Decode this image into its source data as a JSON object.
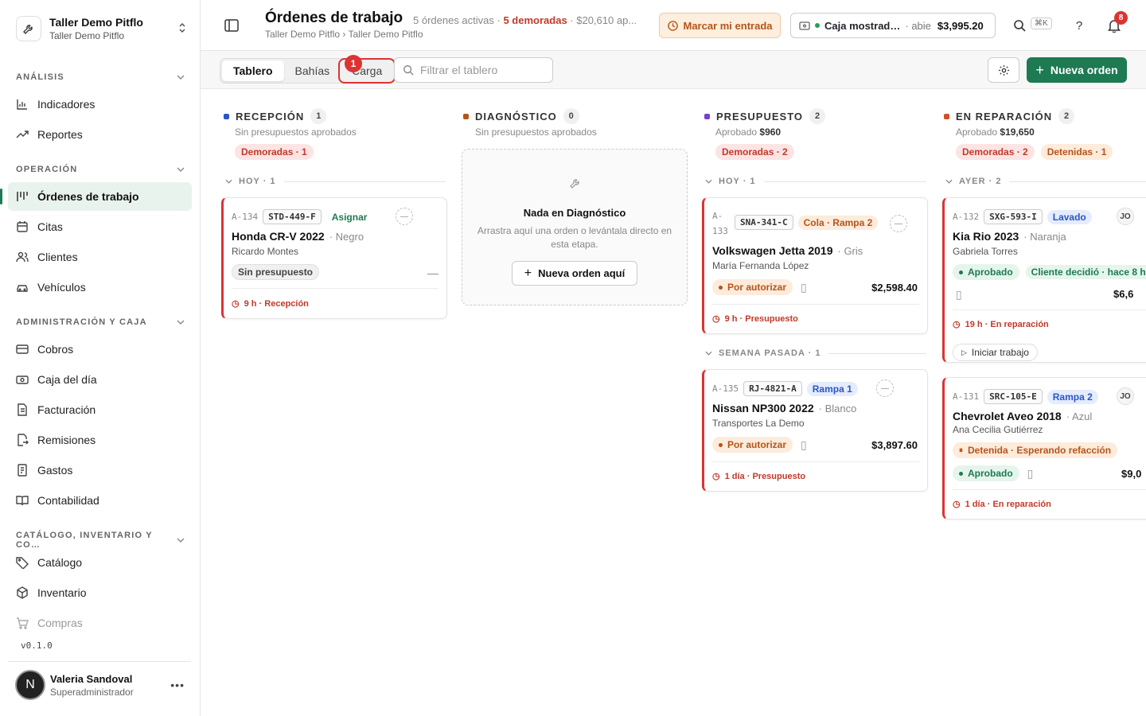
{
  "sidebar": {
    "workspace": {
      "name": "Taller Demo Pitflo",
      "sub": "Taller Demo Pitflo"
    },
    "sections": [
      {
        "label": "ANÁLISIS"
      },
      {
        "label": "OPERACIÓN"
      },
      {
        "label": "ADMINISTRACIÓN Y CAJA"
      },
      {
        "label": "CATÁLOGO, INVENTARIO Y CO…"
      }
    ],
    "items": [
      {
        "label": "Indicadores"
      },
      {
        "label": "Reportes"
      },
      {
        "label": "Órdenes de trabajo"
      },
      {
        "label": "Citas"
      },
      {
        "label": "Clientes"
      },
      {
        "label": "Vehículos"
      },
      {
        "label": "Cobros"
      },
      {
        "label": "Caja del día"
      },
      {
        "label": "Facturación"
      },
      {
        "label": "Remisiones"
      },
      {
        "label": "Gastos"
      },
      {
        "label": "Contabilidad"
      },
      {
        "label": "Catálogo"
      },
      {
        "label": "Inventario"
      },
      {
        "label": "Compras"
      }
    ],
    "version": "v0.1.0",
    "user": {
      "initial": "N",
      "name": "Valeria Sandoval",
      "role": "Superadministrador"
    }
  },
  "topbar": {
    "title": "Órdenes de trabajo",
    "meta_active": "5 órdenes activas ·",
    "meta_delayed": "5 demoradas",
    "meta_rest": "· $20,610 ap...",
    "breadcrumb": "Taller Demo Pitflo › Taller Demo Pitflo",
    "checkin_label": "Marcar mi entrada",
    "register": {
      "name": "Caja mostrad…",
      "status": "abie",
      "amount": "$3,995.20"
    },
    "shortcut": "⌘K",
    "help": "?",
    "notifications": "8"
  },
  "toolbar": {
    "tabs": [
      "Tablero",
      "Bahías",
      "Carga"
    ],
    "marker": "1",
    "filter_placeholder": "Filtrar el tablero",
    "new_order": "Nueva orden"
  },
  "columns": [
    {
      "title": "RECEPCIÓN",
      "count": "1",
      "color": "#2a56c6",
      "sub": "Sin presupuestos aprobados",
      "pills": [
        "Demoradas · 1"
      ],
      "groups": [
        "HOY · 1"
      ],
      "cards": [
        {
          "id": "A-134",
          "plate": "STD-449-F",
          "tag": "Asignar",
          "vehicle": "Honda CR-V 2022",
          "color": "Negro",
          "customer": "Ricardo Montes",
          "status": "Sin presupuesto",
          "dash": "—",
          "footer": "9 h · Recepción"
        }
      ]
    },
    {
      "title": "DIAGNÓSTICO",
      "count": "0",
      "color": "#b5541a",
      "sub": "Sin presupuestos aprobados",
      "empty": {
        "title": "Nada en Diagnóstico",
        "desc": "Arrastra aquí una orden o levántala directo en esta etapa.",
        "button": "Nueva orden aquí"
      }
    },
    {
      "title": "PRESUPUESTO",
      "count": "2",
      "color": "#7b3fd1",
      "sub_label": "Aprobado",
      "sub_value": "$960",
      "pills": [
        "Demoradas · 2"
      ],
      "groups": [
        "HOY · 1",
        "SEMANA PASADA · 1"
      ],
      "cards": [
        {
          "id_a": "A-",
          "id_b": "133",
          "plate": "SNA-341-C",
          "tag": "Cola · Rampa 2",
          "vehicle": "Volkswagen Jetta 2019",
          "color": "Gris",
          "customer": "María Fernanda López",
          "status": "Por autorizar",
          "amount": "$2,598.40",
          "footer": "9 h · Presupuesto"
        },
        {
          "id": "A-135",
          "plate": "RJ-4821-A",
          "tag": "Rampa 1",
          "vehicle": "Nissan NP300 2022",
          "color": "Blanco",
          "customer": "Transportes La Demo",
          "status": "Por autorizar",
          "amount": "$3,897.60",
          "footer": "1 día · Presupuesto"
        }
      ]
    },
    {
      "title": "EN REPARACIÓN",
      "count": "2",
      "color": "#d3502b",
      "sub_label": "Aprobado",
      "sub_value": "$19,650",
      "pills": [
        "Demoradas · 2",
        "Detenidas · 1"
      ],
      "groups": [
        "AYER · 2"
      ],
      "cards": [
        {
          "id": "A-132",
          "plate": "SXG-593-I",
          "tag": "Lavado",
          "avatar": "JO",
          "vehicle": "Kia Rio 2023",
          "color": "Naranja",
          "customer": "Gabriela Torres",
          "status": "Aprobado",
          "decision": "Cliente decidió · hace 8 h",
          "amount": "$6,6",
          "footer": "19 h · En reparación",
          "action": "Iniciar trabajo"
        },
        {
          "id": "A-131",
          "plate": "SRC-105-E",
          "tag": "Rampa 2",
          "avatar": "JO",
          "vehicle": "Chevrolet Aveo 2018",
          "color": "Azul",
          "customer": "Ana Cecilia Gutiérrez",
          "hold": "Detenida · Esperando refacción",
          "status": "Aprobado",
          "amount": "$9,0",
          "footer": "1 día · En reparación"
        }
      ]
    }
  ]
}
